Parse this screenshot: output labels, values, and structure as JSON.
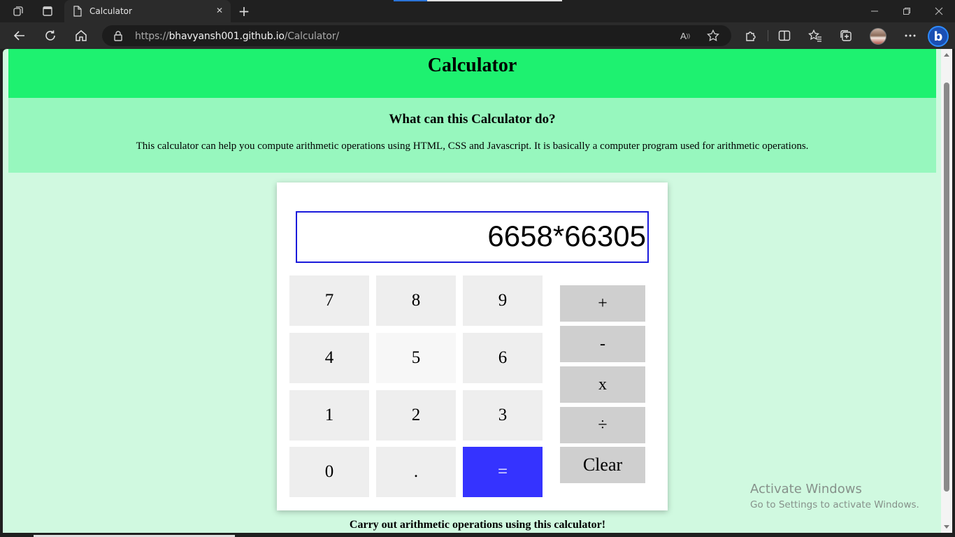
{
  "browser": {
    "tab_title": "Calculator",
    "url_prefix": "https://",
    "url_host": "bhavyansh001.github.io",
    "url_path": "/Calculator/",
    "page_load_progress_fraction": 0.2
  },
  "page": {
    "title": "Calculator",
    "info_heading": "What can this Calculator do?",
    "info_text": "This calculator can help you compute arithmetic operations using HTML, CSS and Javascript. It is basically a computer program used for arithmetic operations.",
    "footer_text": "Carry out arithmetic operations using this calculator!"
  },
  "calculator": {
    "display": "6658*66305",
    "keys": [
      "7",
      "8",
      "9",
      "4",
      "5",
      "6",
      "1",
      "2",
      "3",
      "0",
      ".",
      "="
    ],
    "operators": [
      "+",
      "-",
      "x",
      "÷",
      "Clear"
    ],
    "equals_color": "#3533ff"
  },
  "watermark": {
    "line1": "Activate Windows",
    "line2": "Go to Settings to activate Windows."
  },
  "colors": {
    "header_bg": "#1ef170",
    "info_bg": "#97f7be",
    "page_bg": "#d0f9e0",
    "display_border": "#1a1adb"
  }
}
